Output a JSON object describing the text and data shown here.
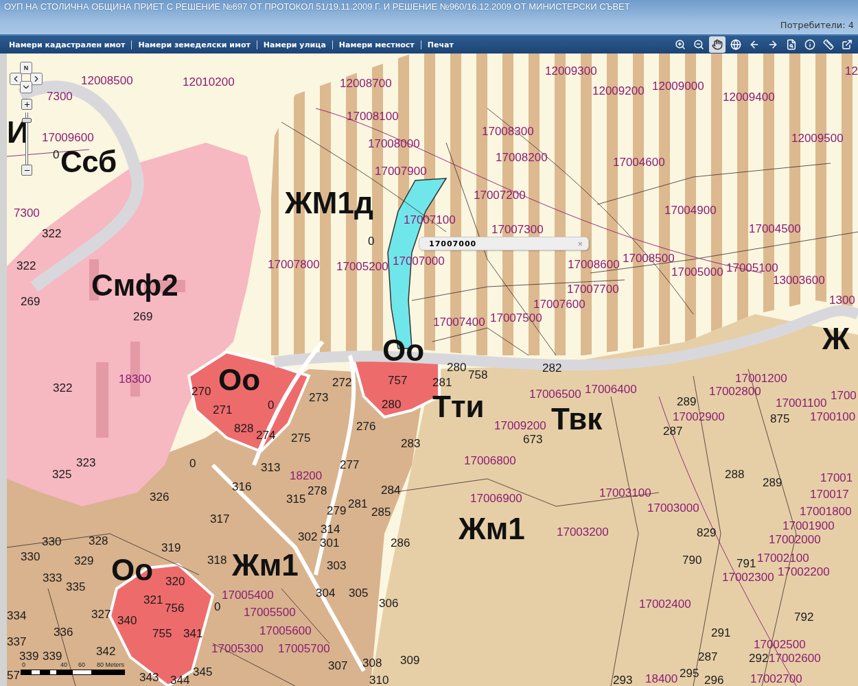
{
  "header": {
    "title": "ОУП НА СТОЛИЧНА ОБЩИНА ПРИЕТ С РЕШЕНИЕ №697 ОТ ПРОТОКОЛ 51/19.11.2009 Г. И РЕШЕНИЕ №960/16.12.2009 ОТ МИНИСТЕРСКИ СЪВЕТ",
    "users": "Потребители: 4"
  },
  "menu": [
    {
      "label": "Намери кадастрален имот"
    },
    {
      "label": "Намери земеделски имот"
    },
    {
      "label": "Намери улица"
    },
    {
      "label": "Намери местност"
    },
    {
      "label": "Печат"
    }
  ],
  "map": {
    "north": "N",
    "zoom": {
      "level": 0.88
    },
    "popup": {
      "title": "17007000",
      "close": "×"
    },
    "scale": {
      "ticks": [
        "0",
        "40",
        "60",
        "80 Meters"
      ]
    },
    "zones": [
      "И",
      "Ссб",
      "ЖМ1д",
      "Смф2",
      "Оо",
      "Оо",
      "Ж",
      "Тти",
      "Твк",
      "Жм1",
      "Оо",
      "Жм1"
    ],
    "parcels": [
      "7300",
      "12008500",
      "12010200",
      "12008700",
      "12009300",
      "12009200",
      "12009000",
      "12009400",
      "12",
      "17009600",
      "17008100",
      "17008000",
      "17007900",
      "17008300",
      "17008200",
      "17004600",
      "12009500",
      "7300",
      "17007100",
      "17007200",
      "17007300",
      "17004900",
      "17004500",
      "17007800",
      "17005200",
      "17007000",
      "17008600",
      "17008500",
      "17005000",
      "17005100",
      "17007700",
      "13003600",
      "17007600",
      "1300",
      "17007400",
      "17007500",
      "18300",
      "17006500",
      "17006400",
      "17001200",
      "17002800",
      "17001100",
      "1700",
      "17009200",
      "17002900",
      "1700100",
      "17006800",
      "18200",
      "17001",
      "17006900",
      "17003100",
      "170017",
      "17003000",
      "17001800",
      "17003200",
      "17001900",
      "17002000",
      "17002100",
      "17002300",
      "17002200",
      "17005400",
      "17005500",
      "17002400",
      "17005600",
      "17005300",
      "17005700",
      "17002500",
      "17002600",
      "18400",
      "17002700"
    ],
    "numbers": [
      "0",
      "322",
      "0",
      "322",
      "269",
      "269",
      "322",
      "270",
      "271",
      "0",
      "273",
      "272",
      "757",
      "280",
      "280",
      "281",
      "758",
      "282",
      "289",
      "828",
      "274",
      "275",
      "276",
      "283",
      "673",
      "287",
      "875",
      "325",
      "323",
      "0",
      "313",
      "277",
      "326",
      "317",
      "316",
      "315",
      "278",
      "279",
      "281",
      "284",
      "285",
      "288",
      "289",
      "330",
      "330",
      "328",
      "329",
      "319",
      "302",
      "314",
      "301",
      "286",
      "829",
      "333",
      "335",
      "320",
      "318",
      "303",
      "790",
      "791",
      "334",
      "337",
      "336",
      "327",
      "340",
      "321",
      "756",
      "755",
      "341",
      "0",
      "304",
      "305",
      "306",
      "291",
      "792",
      "339",
      "339",
      "57",
      "342",
      "343",
      "344",
      "345",
      "307",
      "308",
      "310",
      "309",
      "293",
      "287",
      "295",
      "296",
      "292"
    ]
  }
}
